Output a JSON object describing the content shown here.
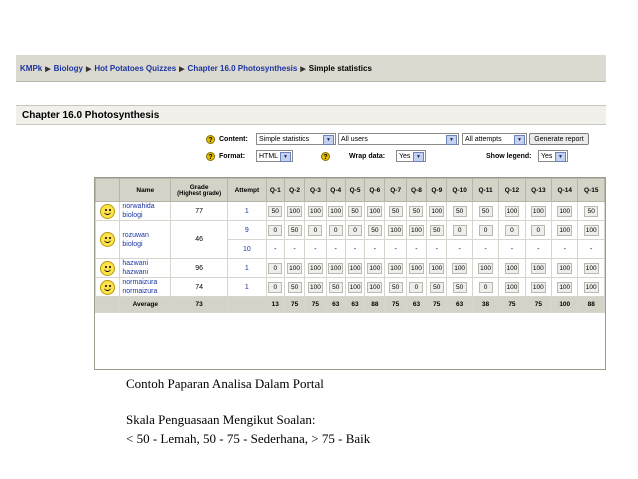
{
  "breadcrumb": [
    "KMPk",
    "Biology",
    "Hot Potatoes Quizzes",
    "Chapter 16.0 Photosynthesis",
    "Simple statistics"
  ],
  "page_title": "Chapter 16.0 Photosynthesis",
  "controls": {
    "content_label": "Content:",
    "content_value": "Simple statistics",
    "users_value": "All users",
    "attempts_value": "All attempts",
    "generate_label": "Generate report",
    "format_label": "Format:",
    "format_value": "HTML",
    "wrap_label": "Wrap data:",
    "wrap_value": "Yes",
    "legend_label": "Show legend:",
    "legend_value": "Yes",
    "help_glyph": "?"
  },
  "table": {
    "headers": {
      "name": "Name",
      "grade": "Grade",
      "grade_sub": "(Highest grade)",
      "attempt": "Attempt",
      "questions": [
        "Q-1",
        "Q-2",
        "Q-3",
        "Q-4",
        "Q-5",
        "Q-6",
        "Q-7",
        "Q-8",
        "Q-9",
        "Q-10",
        "Q-11",
        "Q-12",
        "Q-13",
        "Q-14",
        "Q-15"
      ]
    },
    "rows": [
      {
        "name1": "norwahida",
        "name2": "biologi",
        "grade": "77",
        "attempt": "1",
        "scores": [
          "50",
          "100",
          "100",
          "100",
          "50",
          "100",
          "50",
          "50",
          "100",
          "50",
          "50",
          "100",
          "100",
          "100",
          "50"
        ]
      },
      {
        "name1": "rozuwan",
        "name2": "biologi",
        "grade": "46",
        "attempt": "9",
        "scores": [
          "0",
          "50",
          "0",
          "0",
          "0",
          "50",
          "100",
          "100",
          "50",
          "0",
          "0",
          "0",
          "0",
          "100",
          "100"
        ]
      },
      {
        "name1": "",
        "name2": "",
        "grade": "",
        "attempt": "10",
        "scores": [
          "-",
          "-",
          "-",
          "-",
          "-",
          "-",
          "-",
          "-",
          "-",
          "-",
          "-",
          "-",
          "-",
          "-",
          "-"
        ]
      },
      {
        "name1": "hazwani",
        "name2": "hazwani",
        "grade": "96",
        "attempt": "1",
        "scores": [
          "0",
          "100",
          "100",
          "100",
          "100",
          "100",
          "100",
          "100",
          "100",
          "100",
          "100",
          "100",
          "100",
          "100",
          "100"
        ]
      },
      {
        "name1": "normaizura",
        "name2": "normaizura",
        "grade": "74",
        "attempt": "1",
        "scores": [
          "0",
          "50",
          "100",
          "50",
          "100",
          "100",
          "50",
          "0",
          "50",
          "50",
          "0",
          "100",
          "100",
          "100",
          "100"
        ]
      }
    ],
    "average": {
      "label": "Average",
      "grade": "73",
      "scores": [
        "13",
        "75",
        "75",
        "63",
        "63",
        "88",
        "75",
        "63",
        "75",
        "63",
        "38",
        "75",
        "75",
        "100",
        "88"
      ]
    }
  },
  "captions": {
    "line1": "Contoh Paparan Analisa Dalam Portal",
    "line2": "Skala Penguasaan Mengikut Soalan:",
    "line3": " < 50 - Lemah, 50 - 75 - Sederhana, > 75 - Baik"
  }
}
